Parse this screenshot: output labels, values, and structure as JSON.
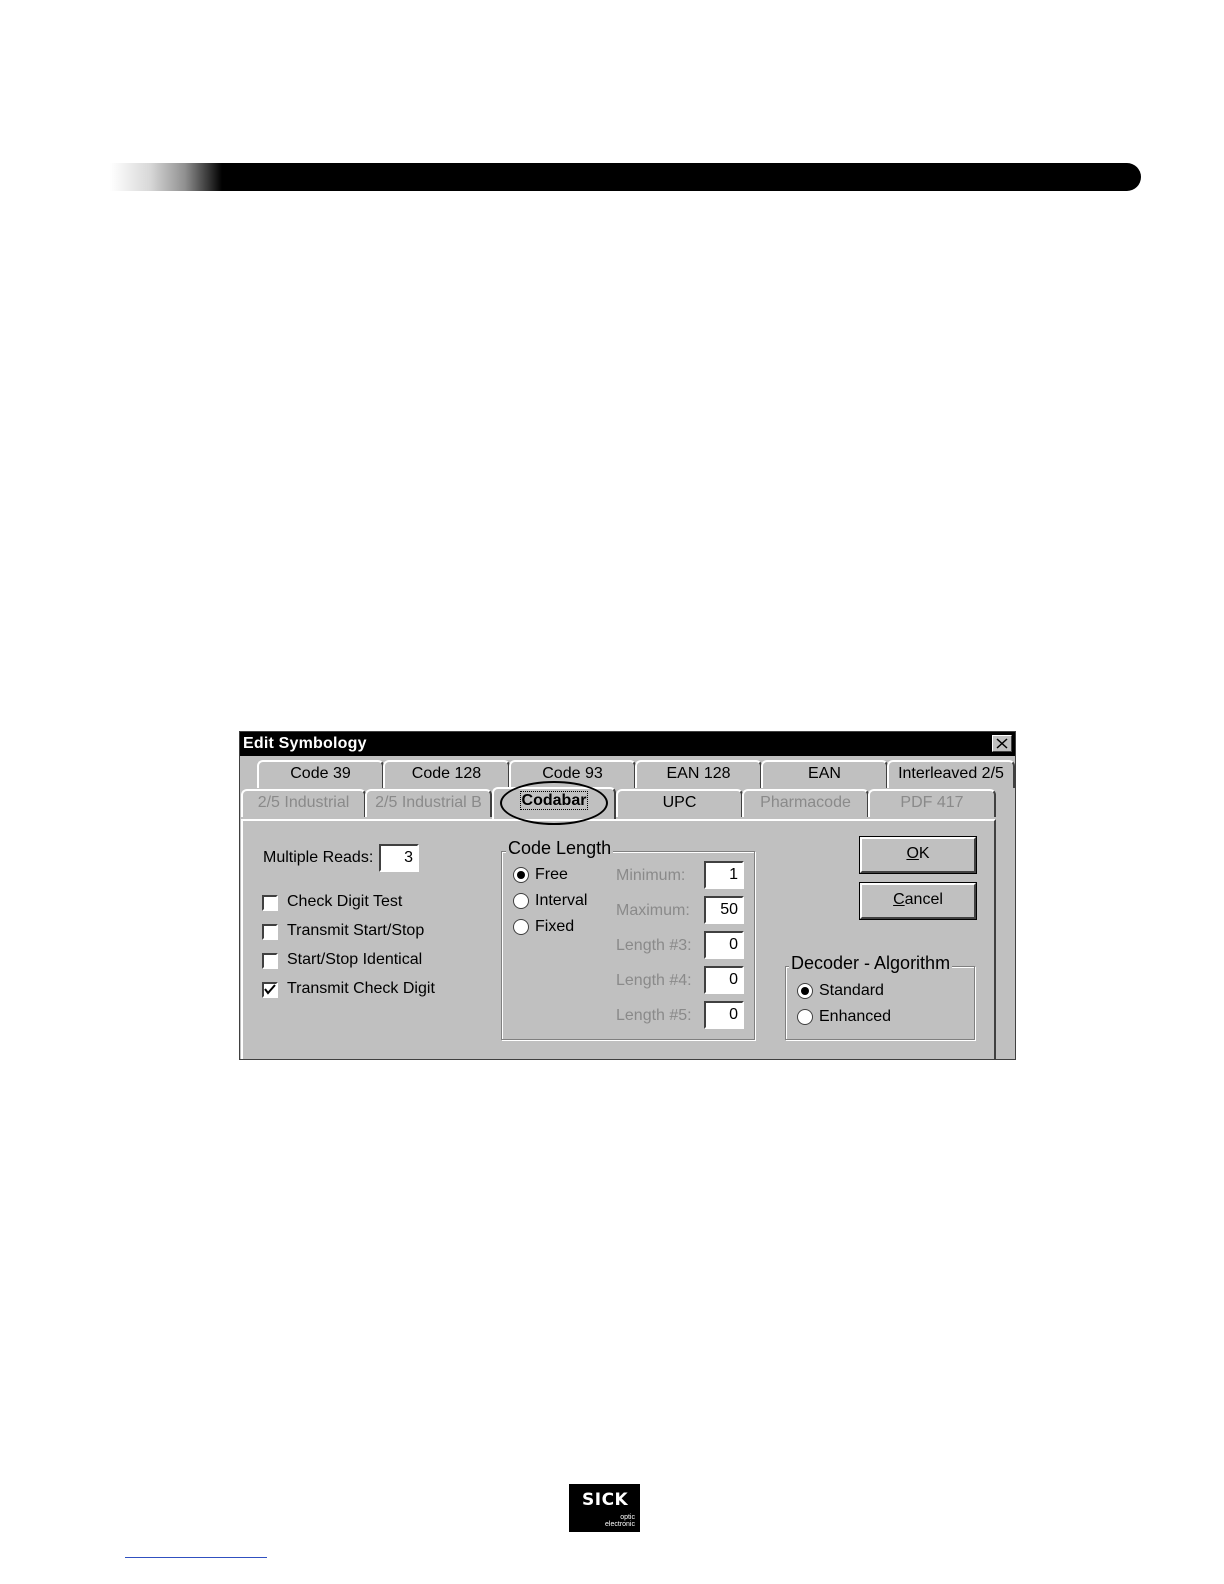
{
  "dialog": {
    "title": "Edit Symbology",
    "tabs_row1": [
      "Code 39",
      "Code 128",
      "Code 93",
      "EAN 128",
      "EAN",
      "Interleaved 2/5"
    ],
    "tabs_row2": [
      "2/5 Industrial",
      "2/5 Industrial B",
      "Codabar",
      "UPC",
      "Pharmacode",
      "PDF 417"
    ],
    "active_tab": "Codabar",
    "multiple_reads": {
      "label": "Multiple Reads:",
      "value": "3"
    },
    "checkboxes": [
      {
        "label": "Check Digit Test",
        "checked": false
      },
      {
        "label": "Transmit Start/Stop",
        "checked": false
      },
      {
        "label": "Start/Stop Identical",
        "checked": false
      },
      {
        "label": "Transmit Check Digit",
        "checked": true
      }
    ],
    "code_length": {
      "title": "Code Length",
      "options": [
        "Free",
        "Interval",
        "Fixed"
      ],
      "selected": "Free",
      "fields": [
        {
          "label": "Minimum:",
          "value": "1"
        },
        {
          "label": "Maximum:",
          "value": "50"
        },
        {
          "label": "Length #3:",
          "value": "0"
        },
        {
          "label": "Length #4:",
          "value": "0"
        },
        {
          "label": "Length #5:",
          "value": "0"
        }
      ]
    },
    "decoder": {
      "title": "Decoder - Algorithm",
      "options": [
        "Standard",
        "Enhanced"
      ],
      "selected": "Standard"
    },
    "buttons": {
      "ok_label": "OK",
      "ok_accel": "O",
      "ok_rest": "K",
      "cancel_label": "Cancel",
      "cancel_accel": "C",
      "cancel_rest": "ancel"
    }
  },
  "logo": {
    "name": "SICK",
    "sub1": "optic",
    "sub2": "electronic"
  }
}
